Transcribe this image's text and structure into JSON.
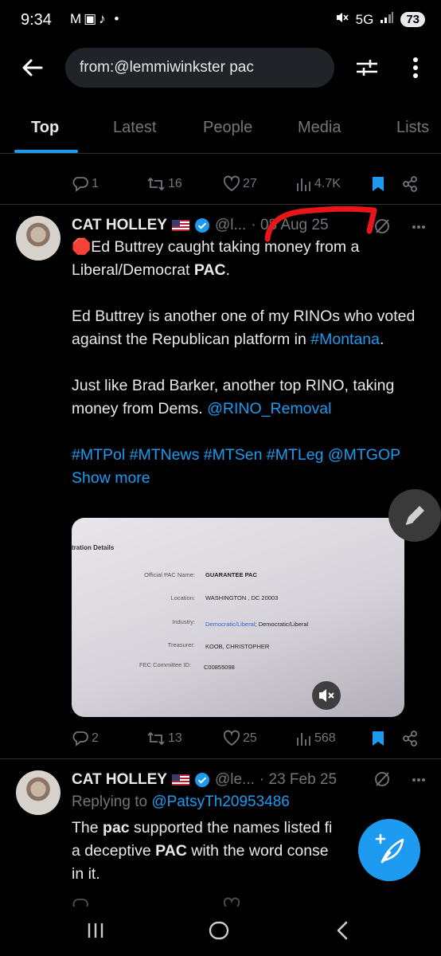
{
  "status_bar": {
    "time": "9:34",
    "left_icons": "M▣♪ •",
    "network": "5G",
    "battery": "73"
  },
  "search": {
    "query": "from:@lemmiwinkster pac"
  },
  "tabs": [
    {
      "label": "Top",
      "active": true
    },
    {
      "label": "Latest",
      "active": false
    },
    {
      "label": "People",
      "active": false
    },
    {
      "label": "Media",
      "active": false
    },
    {
      "label": "Lists",
      "active": false
    }
  ],
  "prev_tweet_actions": {
    "replies": "1",
    "reposts": "16",
    "likes": "27",
    "views": "4.7K"
  },
  "tweet1": {
    "name": "CAT HOLLEY",
    "handle": "@l...",
    "date": "· 08 Aug 25",
    "text": {
      "p1_emoji": "🛑",
      "p1_a": "Ed Buttrey caught taking money from a Liberal/Democrat ",
      "p1_bold": "PAC",
      "p1_b": ".",
      "p2_a": "Ed Buttrey is another one of my RINOs who voted against the Republican platform in ",
      "p2_tag": "#Montana",
      "p2_b": ".",
      "p3_a": "Just like Brad Barker, another top RINO, taking money from Dems. ",
      "p3_mention": "@RINO_Removal",
      "p4_tags": "#MTPol #MTNews #MTSen #MTLeg @MTGOP",
      "p4_more": "Show more"
    },
    "media": {
      "heading": "tration Details",
      "rows": [
        {
          "label": "Official PAC Name:",
          "value": "GUARANTEE PAC"
        },
        {
          "label": "Location:",
          "value": "WASHINGTON , DC 20003"
        },
        {
          "label": "Industry:",
          "value_link": "Democratic/Liberal",
          "value": "; Democratic/Liberal"
        },
        {
          "label": "Treasurer:",
          "value": "KOOB, CHRISTOPHER"
        },
        {
          "label": "FEC Committee ID:",
          "value": "C00855098"
        }
      ]
    },
    "actions": {
      "replies": "2",
      "reposts": "13",
      "likes": "25",
      "views": "568"
    }
  },
  "tweet2": {
    "name": "CAT HOLLEY",
    "handle": "@le...",
    "date": "· 23 Feb 25",
    "replying_prefix": "Replying to ",
    "replying_to": "@PatsyTh20953486",
    "text_a1": "The ",
    "text_b1": "pac",
    "text_a2": " supported the names listed fi",
    "text_a3": "a deceptive ",
    "text_b2": "PAC",
    "text_a4": " with the word conse",
    "text_a5": "in it."
  },
  "colors": {
    "accent": "#1d9bf0",
    "annotation": "#e8161b"
  }
}
